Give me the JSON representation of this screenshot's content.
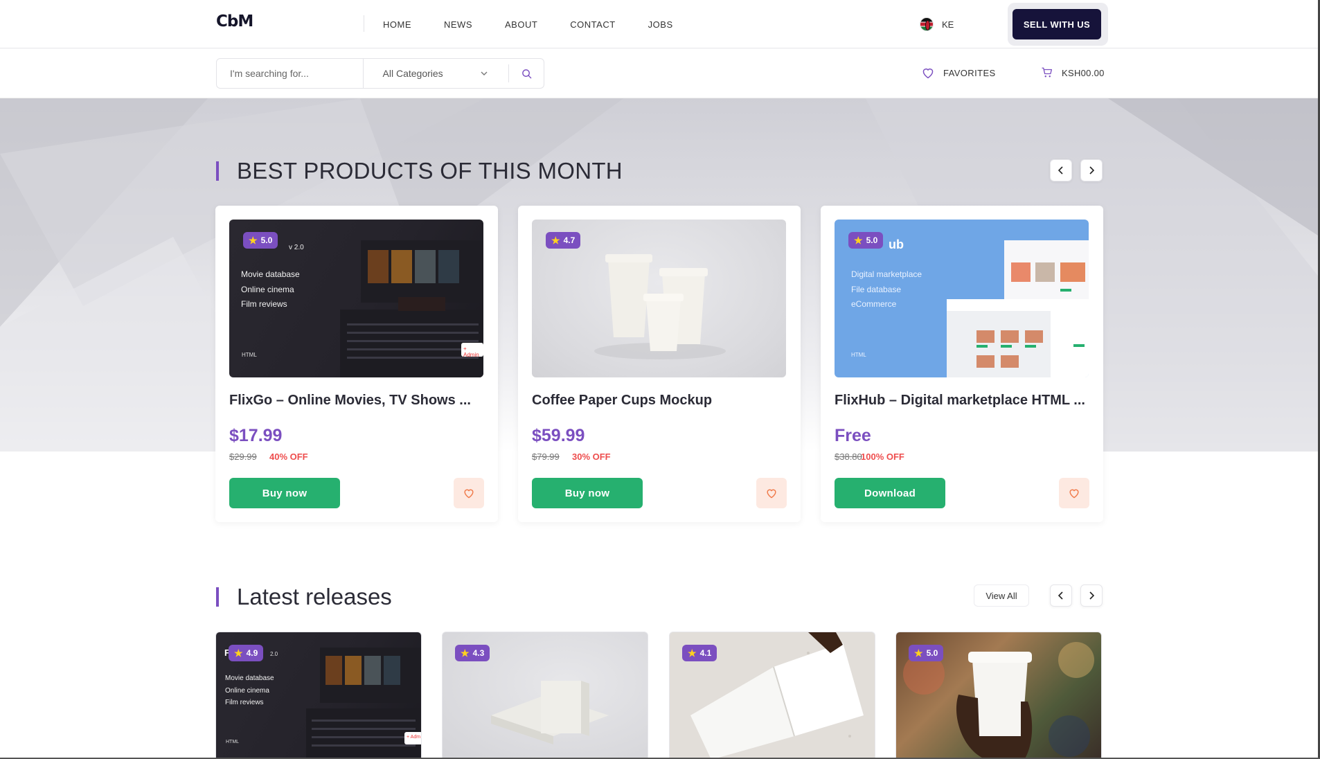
{
  "brand": {
    "logo": "CbM"
  },
  "nav": {
    "items": [
      "HOME",
      "NEWS",
      "ABOUT",
      "CONTACT",
      "JOBS"
    ]
  },
  "locale": {
    "code": "KE",
    "flag_icon": "kenya-flag-icon"
  },
  "header": {
    "sell_label": "SELL WITH US"
  },
  "search": {
    "placeholder": "I'm searching for...",
    "category": "All Categories"
  },
  "favorites": {
    "label": "FAVORITES"
  },
  "cart": {
    "total": "KSH00.00"
  },
  "colors": {
    "accent": "#7b4fc0",
    "buy": "#26b06f",
    "sale": "#ee4d4d",
    "dark": "#16133a"
  },
  "best": {
    "title": "BEST PRODUCTS OF THIS MONTH",
    "products": [
      {
        "rating": "5.0",
        "title": "FlixGo – Online Movies, TV Shows ...",
        "price": "$17.99",
        "old_price": "$29.99",
        "discount": "40% OFF",
        "action": "Buy now",
        "thumb_lines": [
          "Movie database",
          "Online cinema",
          "Film reviews"
        ],
        "thumb_version": "v 2.0",
        "thumb_tag": "HTML",
        "thumb_badge": "+ Admin"
      },
      {
        "rating": "4.7",
        "title": "Coffee Paper Cups Mockup",
        "price": "$59.99",
        "old_price": "$79.99",
        "discount": "30% OFF",
        "action": "Buy now"
      },
      {
        "rating": "5.0",
        "title": "FlixHub – Digital marketplace HTML ...",
        "price": "Free",
        "old_price": "$38.80",
        "discount": "100% OFF",
        "action": "Download",
        "thumb_lines": [
          "Digital marketplace",
          "File database",
          "eCommerce"
        ],
        "thumb_brand": "ub",
        "thumb_tag": "HTML"
      }
    ]
  },
  "latest": {
    "title": "Latest releases",
    "view_all": "View All",
    "items": [
      {
        "rating": "4.9",
        "thumb_lines": [
          "Movie database",
          "Online cinema",
          "Film reviews"
        ],
        "thumb_tag": "HTML",
        "thumb_letter": "F",
        "thumb_version": "2.0",
        "thumb_badge": "+ Adm"
      },
      {
        "rating": "4.3"
      },
      {
        "rating": "4.1"
      },
      {
        "rating": "5.0"
      }
    ]
  }
}
